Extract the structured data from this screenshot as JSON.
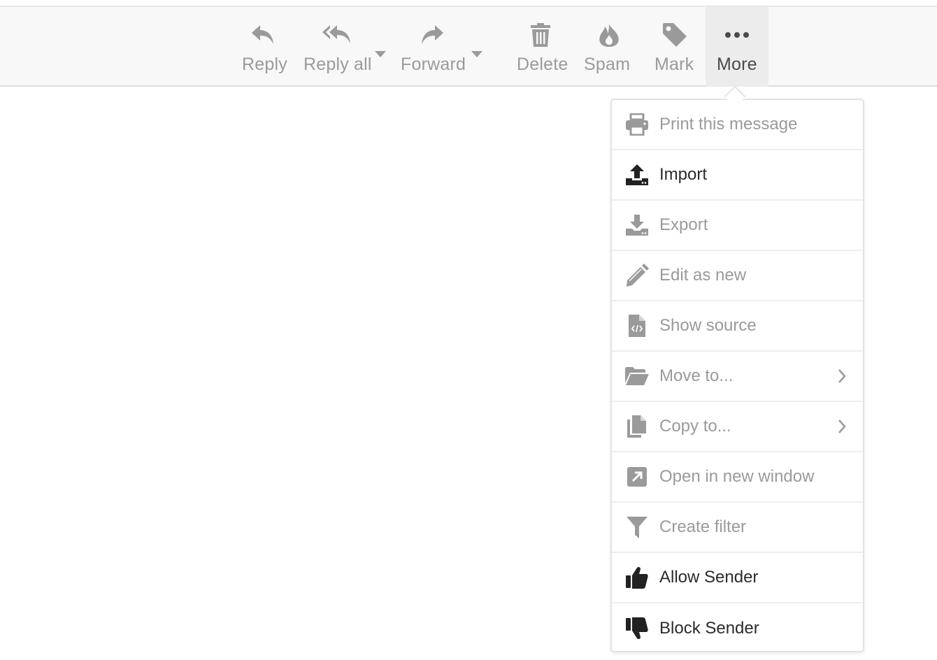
{
  "colors": {
    "toolbar_bg": "#f8f8f8",
    "disabled_text": "#9a9a9a",
    "enabled_text": "#2b2b2b",
    "active_bg": "#ececec"
  },
  "toolbar": {
    "reply": {
      "label": "Reply",
      "icon": "reply-icon"
    },
    "reply_all": {
      "label": "Reply all",
      "icon": "reply-all-icon"
    },
    "forward": {
      "label": "Forward",
      "icon": "forward-icon"
    },
    "delete": {
      "label": "Delete",
      "icon": "trash-icon"
    },
    "spam": {
      "label": "Spam",
      "icon": "fire-icon"
    },
    "mark": {
      "label": "Mark",
      "icon": "tag-icon"
    },
    "more": {
      "label": "More",
      "icon": "ellipsis-icon"
    }
  },
  "more_menu": {
    "items": [
      {
        "label": "Print this message",
        "icon": "printer-icon",
        "enabled": false
      },
      {
        "label": "Import",
        "icon": "upload-icon",
        "enabled": true
      },
      {
        "label": "Export",
        "icon": "download-icon",
        "enabled": false
      },
      {
        "label": "Edit as new",
        "icon": "pencil-icon",
        "enabled": false
      },
      {
        "label": "Show source",
        "icon": "code-file-icon",
        "enabled": false
      },
      {
        "label": "Move to...",
        "icon": "folder-open-icon",
        "enabled": false,
        "submenu": true
      },
      {
        "label": "Copy to...",
        "icon": "copy-icon",
        "enabled": false,
        "submenu": true
      },
      {
        "label": "Open in new window",
        "icon": "external-link-icon",
        "enabled": false
      },
      {
        "label": "Create filter",
        "icon": "funnel-icon",
        "enabled": false
      },
      {
        "label": "Allow Sender",
        "icon": "thumbs-up-icon",
        "enabled": true
      },
      {
        "label": "Block Sender",
        "icon": "thumbs-down-icon",
        "enabled": true
      }
    ]
  }
}
